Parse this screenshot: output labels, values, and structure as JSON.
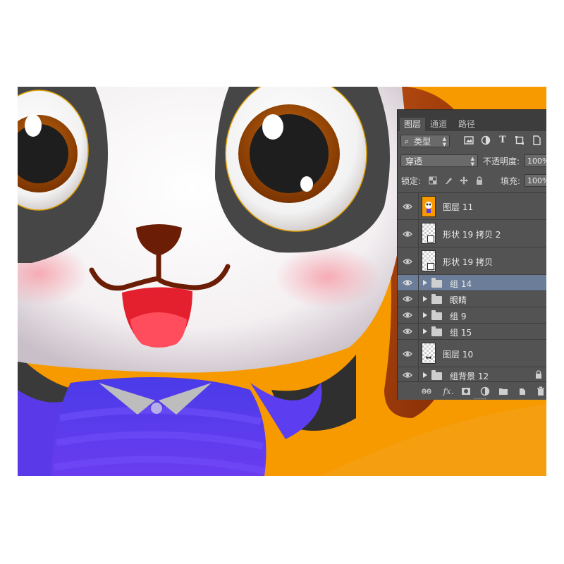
{
  "canvas": {
    "background": "#f79a00",
    "artwork": "panda-character"
  },
  "layers_panel": {
    "tabs": [
      {
        "label": "图层",
        "active": true
      },
      {
        "label": "通道",
        "active": false
      },
      {
        "label": "路径",
        "active": false
      }
    ],
    "filter": {
      "icon": "search-icon",
      "kind_label": "类型",
      "filter_icons": [
        "image-filter-icon",
        "adjustment-filter-icon",
        "type-filter-icon",
        "shape-filter-icon",
        "smart-object-filter-icon"
      ]
    },
    "blend_mode": "穿透",
    "opacity_label": "不透明度:",
    "opacity_value": "100%",
    "lock_label": "锁定:",
    "lock_icons": [
      "lock-transparent-icon",
      "lock-pixels-icon",
      "lock-position-icon",
      "lock-all-icon"
    ],
    "fill_label": "填充:",
    "fill_value": "100%",
    "layers": [
      {
        "name": "图层 11",
        "kind": "pixel",
        "visible": true,
        "selected": false
      },
      {
        "name": "形状 19 拷贝 2",
        "kind": "shape",
        "visible": true,
        "selected": false
      },
      {
        "name": "形状 19 拷贝",
        "kind": "shape",
        "visible": true,
        "selected": false
      },
      {
        "name": "组 14",
        "kind": "group",
        "visible": true,
        "selected": true
      },
      {
        "name": "眼睛",
        "kind": "group",
        "visible": true,
        "selected": false
      },
      {
        "name": "组 9",
        "kind": "group",
        "visible": true,
        "selected": false
      },
      {
        "name": "组 15",
        "kind": "group",
        "visible": true,
        "selected": false
      },
      {
        "name": "图层 10",
        "kind": "pixel",
        "visible": true,
        "selected": false
      },
      {
        "name": "组背景 12",
        "kind": "group",
        "visible": true,
        "selected": false,
        "locked": true
      }
    ],
    "bottom_icons": [
      "link-layers-icon",
      "fx-icon",
      "add-mask-icon",
      "adjustment-layer-icon",
      "new-group-icon",
      "new-layer-icon",
      "delete-layer-icon"
    ],
    "fx_label": "fx."
  }
}
